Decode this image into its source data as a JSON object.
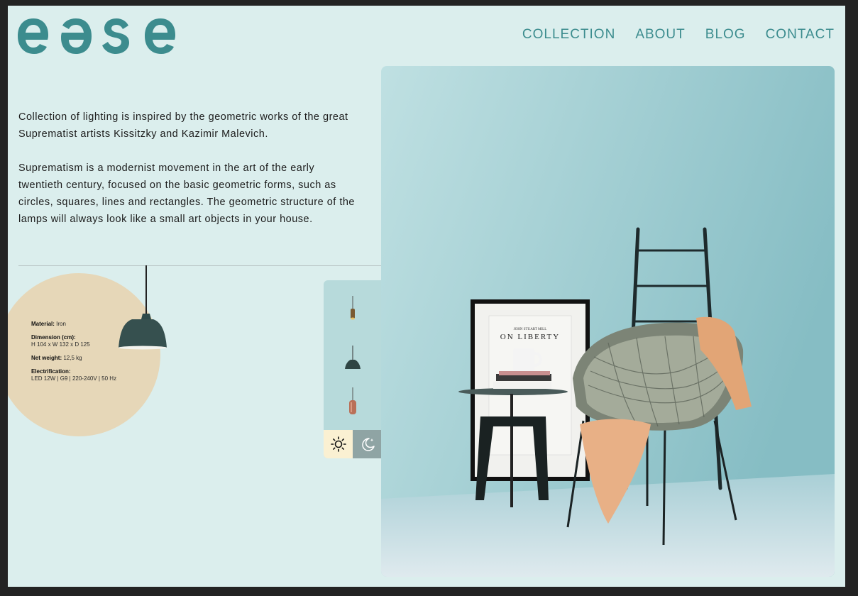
{
  "brand": {
    "logo_text": "ease",
    "accent_color": "#3c8c8e",
    "background": "#dbeeed"
  },
  "nav": {
    "items": [
      {
        "label": "COLLECTION"
      },
      {
        "label": "ABOUT"
      },
      {
        "label": "BLOG"
      },
      {
        "label": "CONTACT"
      }
    ]
  },
  "intro": {
    "p1": "Collection of lighting is inspired by the geometric works of the great Suprematist artists Kissitzky and Kazimir Malevich.",
    "p2": "Suprematism is a modernist movement in the art of the early twentieth century, focused on the basic geometric forms, such as circles, squares, lines and rectangles. The geometric structure of the lamps will always look like a small art objects in your house."
  },
  "specs": {
    "material_label": "Material:",
    "material_value": "Iron",
    "dimension_label": "Dimension (cm):",
    "dimension_value": "H 104 x W 132 x D 125",
    "weight_label": "Net weight:",
    "weight_value": "12,5 kg",
    "electrification_label": "Electrification:",
    "electrification_value": "LED 12W | G9 | 220-240V | 50 Hz"
  },
  "selector": {
    "thumbnails": [
      "brass-pendant-thumbnail",
      "dark-pendant-thumbnail",
      "copper-pendant-thumbnail"
    ],
    "modes": [
      "sun-icon",
      "moon-icon"
    ]
  },
  "hero": {
    "poster_author": "JOHN STUART MILL",
    "poster_title": "ON LIBERTY"
  }
}
